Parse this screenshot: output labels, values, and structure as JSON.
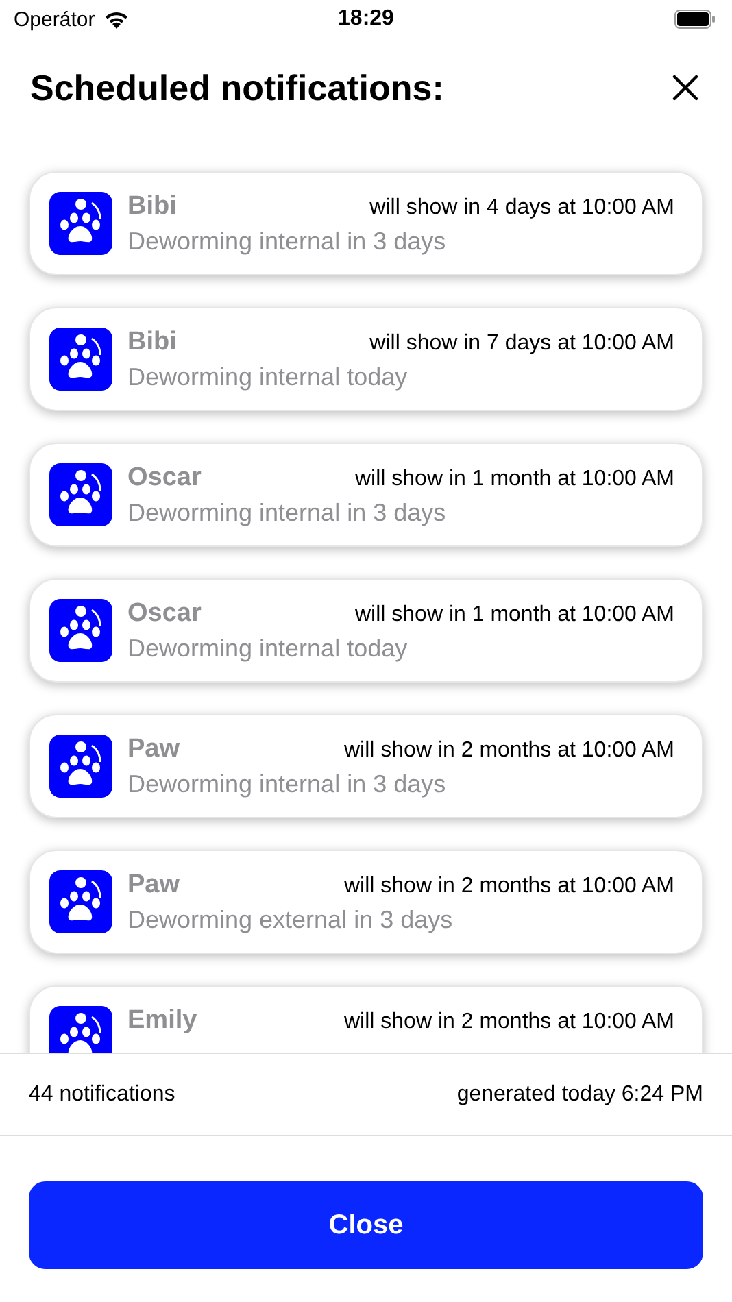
{
  "status_bar": {
    "carrier": "Operátor",
    "time": "18:29"
  },
  "title": "Scheduled notifications:",
  "notifications": [
    {
      "name": "Bibi",
      "when": "will show in 4 days at 10:00 AM",
      "message": "Deworming internal in 3 days"
    },
    {
      "name": "Bibi",
      "when": "will show in 7 days at 10:00 AM",
      "message": "Deworming internal today"
    },
    {
      "name": "Oscar",
      "when": "will show in 1 month at 10:00 AM",
      "message": "Deworming internal in 3 days"
    },
    {
      "name": "Oscar",
      "when": "will show in 1 month at 10:00 AM",
      "message": "Deworming internal today"
    },
    {
      "name": "Paw",
      "when": "will show in 2 months at 10:00 AM",
      "message": "Deworming internal in 3 days"
    },
    {
      "name": "Paw",
      "when": "will show in 2 months at 10:00 AM",
      "message": "Deworming external in 3 days"
    },
    {
      "name": "Emily",
      "when": "will show in 2 months at 10:00 AM"
    }
  ],
  "footer": {
    "count": "44 notifications",
    "generated": "generated today 6:24 PM"
  },
  "close_button": "Close"
}
